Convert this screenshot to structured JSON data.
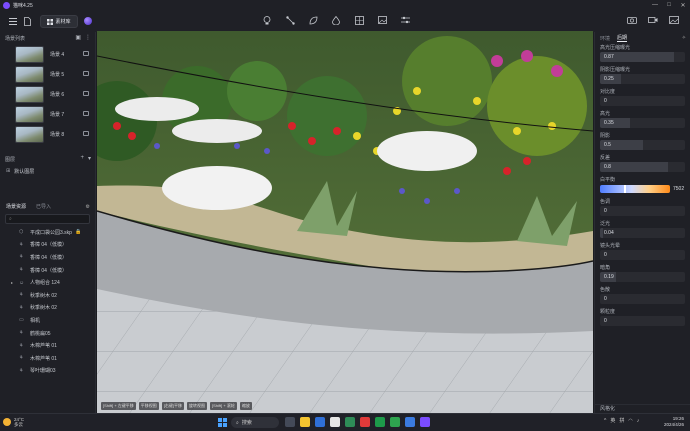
{
  "window": {
    "title": "猫咪4.25",
    "controls": [
      "—",
      "□",
      "✕"
    ]
  },
  "toolbar": {
    "material_label": "素材库",
    "icons_left": [
      "menu-icon",
      "new-file-icon"
    ],
    "icons_center": [
      "light-bulb-icon",
      "path-tool-icon",
      "leaf-icon",
      "water-drop-icon",
      "board-icon",
      "image-icon",
      "sliders-icon"
    ],
    "icons_right": [
      "camera-icon",
      "video-icon",
      "picture-icon"
    ]
  },
  "scene_list": {
    "header": "场景列表",
    "items": [
      {
        "label": "场景 4"
      },
      {
        "label": "场景 5"
      },
      {
        "label": "场景 6"
      },
      {
        "label": "场景 7"
      },
      {
        "label": "场景 8"
      }
    ]
  },
  "layers": {
    "header": "图层",
    "items": [
      {
        "label": "默认图层"
      }
    ]
  },
  "assets": {
    "tabs": [
      "场景资源",
      "已导入"
    ],
    "search_placeholder": "",
    "items": [
      {
        "label": "平成口袋公园3.skp",
        "icon": "cube-icon",
        "caret": "",
        "lock": "🔒"
      },
      {
        "label": "香樟 04（低模）",
        "icon": "tree-icon",
        "caret": "",
        "lock": ""
      },
      {
        "label": "香樟 04（低模）",
        "icon": "tree-icon",
        "caret": "",
        "lock": ""
      },
      {
        "label": "香樟 04（低模）",
        "icon": "tree-icon",
        "caret": "",
        "lock": ""
      },
      {
        "label": "人物组合 124",
        "icon": "people-icon",
        "caret": "▸",
        "lock": ""
      },
      {
        "label": "秋季树木 02",
        "icon": "tree-icon",
        "caret": "",
        "lock": ""
      },
      {
        "label": "秋季树木 02",
        "icon": "tree-icon",
        "caret": "",
        "lock": ""
      },
      {
        "label": "相机",
        "icon": "camera-icon",
        "caret": "",
        "lock": ""
      },
      {
        "label": "鹤桃扁05",
        "icon": "tree-icon",
        "caret": "",
        "lock": ""
      },
      {
        "label": "木棉芦苇 01",
        "icon": "tree-icon",
        "caret": "",
        "lock": ""
      },
      {
        "label": "木棉芦苇 01",
        "icon": "tree-icon",
        "caret": "",
        "lock": ""
      },
      {
        "label": "琴叶珊瑚03",
        "icon": "tree-icon",
        "caret": "",
        "lock": ""
      }
    ]
  },
  "viewport": {
    "hints": [
      "[Shift] + 左键平移",
      "平移视图",
      "[右键]平移",
      "旋转视图",
      "[Shift] + 滚轮",
      "缩放"
    ]
  },
  "properties": {
    "tabs": [
      "环境",
      "后期"
    ],
    "active_tab": "后期",
    "params": [
      {
        "label": "高光压缩曝光",
        "value": "0.87",
        "fill": 0.87
      },
      {
        "label": "阴影压缩曝光",
        "value": "0.25",
        "fill": 0.25
      },
      {
        "label": "对比度",
        "value": "0",
        "fill": 0
      },
      {
        "label": "高光",
        "value": "0.35",
        "fill": 0.35
      },
      {
        "label": "阴影",
        "value": "0.5",
        "fill": 0.5
      },
      {
        "label": "反差",
        "value": "0.8",
        "fill": 0.8
      }
    ],
    "white_balance": {
      "label": "白平衡",
      "value": "7502"
    },
    "params2": [
      {
        "label": "色调",
        "value": "0",
        "fill": 0
      },
      {
        "label": "泛光",
        "value": "0.04",
        "fill": 0.04
      },
      {
        "label": "镜头光晕",
        "value": "0",
        "fill": 0
      },
      {
        "label": "暗角",
        "value": "0.19",
        "fill": 0.19
      },
      {
        "label": "色散",
        "value": "0",
        "fill": 0
      },
      {
        "label": "颗粒度",
        "value": "0",
        "fill": 0
      }
    ],
    "footer": "风格化"
  },
  "taskbar": {
    "weather_temp": "24°C",
    "weather_desc": "多云",
    "search_label": "搜索",
    "tray": [
      "^",
      "英",
      "拼"
    ],
    "time": "19:26",
    "date": "2024/4/26"
  }
}
